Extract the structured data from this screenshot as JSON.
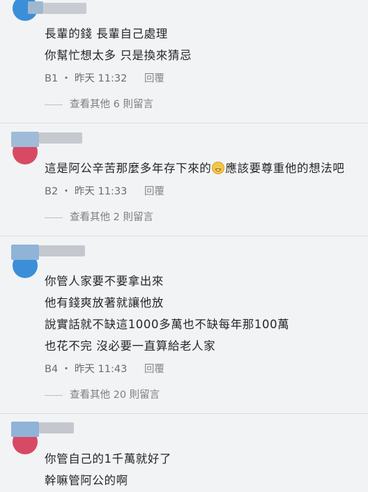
{
  "comments": [
    {
      "lines": [
        "長輩的錢 長輩自己處理",
        "你幫忙想太多 只是換來猜忌"
      ],
      "floor": "B1",
      "time": "昨天 11:32",
      "reply": "回覆",
      "more": "查看其他 6 則留言"
    },
    {
      "line_pre": "這是阿公辛苦那麼多年存下來的",
      "line_post": "應該要尊重他的想法吧",
      "emoji": "grinning-sweat-emoji",
      "floor": "B2",
      "time": "昨天 11:33",
      "reply": "回覆",
      "more": "查看其他 2 則留言"
    },
    {
      "lines": [
        "你管人家要不要拿出來",
        "他有錢爽放著就讓他放",
        "說實話就不缺這1000多萬也不缺每年那100萬",
        "也花不完 沒必要一直算給老人家"
      ],
      "floor": "B4",
      "time": "昨天 11:43",
      "reply": "回覆",
      "more": "查看其他 20 則留言"
    },
    {
      "lines": [
        "你管自己的1千萬就好了",
        "幹嘛管阿公的啊"
      ]
    }
  ],
  "separator": "・",
  "colors": {
    "background": "#f2f3f5",
    "divider": "#dcdde0",
    "text": "#262626",
    "meta": "#6b6b6b"
  }
}
